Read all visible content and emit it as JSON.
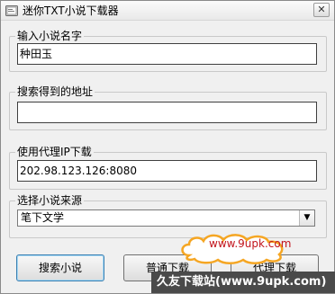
{
  "window": {
    "title": "迷你TXT小说下载器",
    "close_glyph": "✕"
  },
  "fields": {
    "novel_name": {
      "label": "输入小说名字",
      "value": "种田玉"
    },
    "search_address": {
      "label": "搜索得到的地址",
      "value": ""
    },
    "proxy_ip": {
      "label": "使用代理IP下载",
      "value": "202.98.123.126:8080"
    },
    "novel_source": {
      "label": "选择小说来源",
      "value": "笔下文学",
      "arrow_glyph": "▼"
    }
  },
  "buttons": {
    "search": "搜索小说",
    "normal_download": "普通下载",
    "proxy_download": "代理下载"
  },
  "watermark": {
    "cloud_text": "www.9upk.com",
    "site_text": "久友下载站(www.9upk.com)"
  },
  "colors": {
    "window_bg": "#f0f0f0",
    "watermark_red": "#c2141c",
    "cloud_orange": "#f5a623"
  }
}
